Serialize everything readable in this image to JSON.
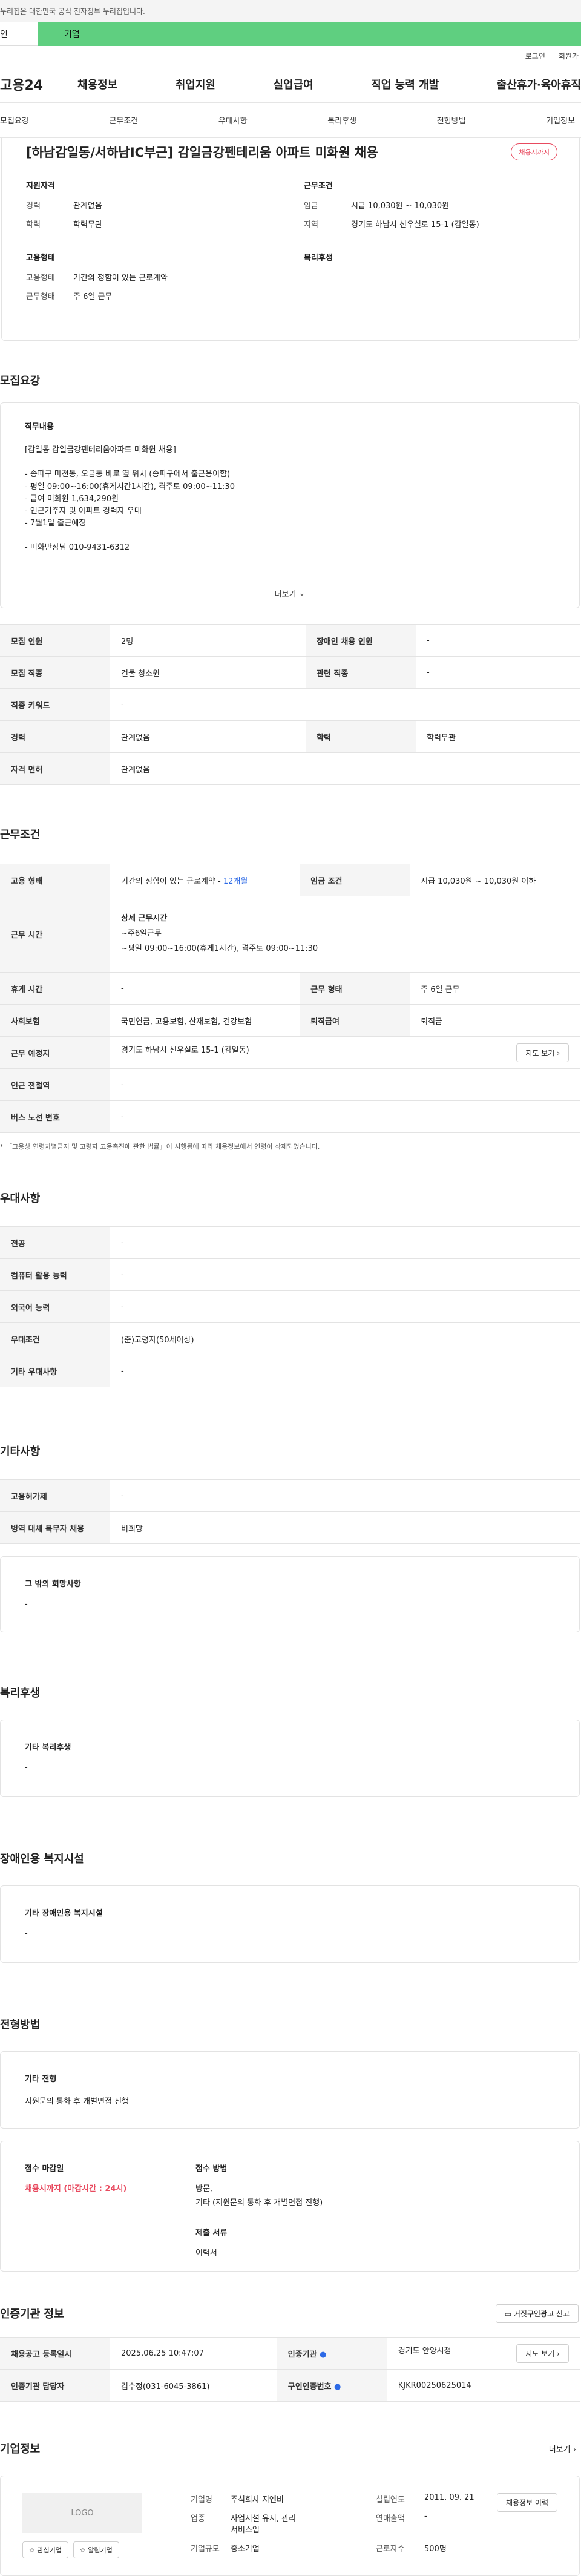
{
  "gov_notice": "누리집은 대한민국 공식 전자정부 누리집입니다.",
  "tabs": {
    "personal": "인",
    "company": "기업"
  },
  "util": {
    "login": "로그인",
    "signup": "회원가"
  },
  "logo": "고용24",
  "gnb": [
    "채용정보",
    "취업지원",
    "실업급여",
    "직업 능력 개발",
    "출산휴가·육아휴직"
  ],
  "anchors": [
    "모집요강",
    "근무조건",
    "우대사항",
    "복리후생",
    "전형방법",
    "기업정보"
  ],
  "job": {
    "title": "[하남감일동/서하남IC부근] 감일금강펜테리움 아파트 미화원 채용",
    "status": "채용시까지",
    "summary": {
      "qual_h": "지원자격",
      "career_k": "경력",
      "career_v": "관계없음",
      "edu_k": "학력",
      "edu_v": "학력무관",
      "cond_h": "근무조건",
      "wage_k": "임금",
      "wage_v": "시급 10,030원 ~ 10,030원",
      "area_k": "지역",
      "area_v": "경기도 하남시 신우실로 15-1 (감일동)",
      "emp_h": "고용형태",
      "emptype_k": "고용형태",
      "emptype_v": "기간의 정함이 있는 근로계약",
      "worktype_k": "근무형태",
      "worktype_v": "주 6일 근무",
      "welfare_h": "복리후생"
    }
  },
  "recruit": {
    "title": "모집요강",
    "duty_h": "직무내용",
    "duty_text": "[감일동   감일금강펜테리움아파트 미화원 채용]\n\n- 송파구 마천동, 오금동 바로 옆 위치 (송파구에서 출근용이함)\n- 평일 09:00~16:00(휴게시간1시간), 격주토 09:00~11:30\n- 급여 미화원 1,634,290원\n- 인근거주자 및 아파트 경력자 우대\n- 7월1일 출근예정\n\n- 미화반장님 010-9431-6312",
    "more": "더보기",
    "rows": [
      [
        "모집 인원",
        "2명",
        "장애인 채용 인원",
        "-"
      ],
      [
        "모집 직종",
        "건물 청소원",
        "관련 직종",
        "-"
      ],
      [
        "직종 키워드",
        "-"
      ],
      [
        "경력",
        "관계없음",
        "학력",
        "학력무관"
      ],
      [
        "자격 면허",
        "관계없음"
      ]
    ]
  },
  "work": {
    "title": "근무조건",
    "emp_k": "고용 형태",
    "emp_v": "기간의 정함이 있는 근로계약 - ",
    "emp_acc": "12개월",
    "wage_k": "임금 조건",
    "wage_v": "시급 10,030원 ~ 10,030원 이하",
    "time_k": "근무 시간",
    "time_h": "상세 근무시간",
    "time_1": "~주6일근무",
    "time_2": "~평일 09:00~16:00(휴게1시간), 격주토 09:00~11:30",
    "rest_k": "휴게 시간",
    "rest_v": "-",
    "form_k": "근무 형태",
    "form_v": "주 6일 근무",
    "ins_k": "사회보험",
    "ins_v": "국민연금, 고용보험, 산재보험, 건강보험",
    "sev_k": "퇴직급여",
    "sev_v": "퇴직금",
    "place_k": "근무 예정지",
    "place_v": "경기도 하남시 신우실로 15-1 (감일동)",
    "map_btn": "지도 보기",
    "sub_k": "인근 전철역",
    "sub_v": "-",
    "bus_k": "버스 노선 번호",
    "bus_v": "-",
    "note": "* 「고용상 연령차별금지 및 고령자 고용촉진에 관한 법률」이 시행됨에 따라 채용정보에서 연령이 삭제되었습니다."
  },
  "prefer": {
    "title": "우대사항",
    "rows": [
      [
        "전공",
        "-"
      ],
      [
        "컴퓨터 활용 능력",
        "-"
      ],
      [
        "외국어 능력",
        "-"
      ],
      [
        "우대조건",
        "(준)고령자(50세이상)"
      ],
      [
        "기타 우대사항",
        "-"
      ]
    ]
  },
  "etc": {
    "title": "기타사항",
    "rows": [
      [
        "고용허가제",
        "-"
      ],
      [
        "병역 대체 복무자 채용",
        "비희망"
      ]
    ],
    "other_h": "그 밖의 희망사항",
    "other_v": "-"
  },
  "welfare": {
    "title": "복리후생",
    "h": "기타 복리후생",
    "v": "-"
  },
  "disabled": {
    "title": "장애인용 복지시설",
    "h": "기타 장애인용 복지시설",
    "v": "-"
  },
  "selection": {
    "title": "전형방법",
    "h": "기타 전형",
    "v": "지원문의 통화 후 개별면접 진행",
    "deadline_h": "접수 마감일",
    "deadline_v": "채용시까지 (마감시간 : 24시)",
    "method_h": "접수 방법",
    "method_1": "방문,",
    "method_2": "기타 (지원문의 통화 후 개별면접 진행)",
    "docs_h": "제출 서류",
    "docs_v": "이력서"
  },
  "cert": {
    "title": "인증기관 정보",
    "report_btn": "거짓구인광고 신고",
    "reg_k": "채용공고 등록일시",
    "reg_v": "2025.06.25 10:47:07",
    "org_k": "인증기관",
    "org_v": "경기도 안양시청",
    "map_btn": "지도 보기",
    "mgr_k": "인증기관 담당자",
    "mgr_v": "김수정(031-6045-3861)",
    "no_k": "구인인증번호",
    "no_v": "KJKR00250625014"
  },
  "company": {
    "title": "기업정보",
    "more": "더보기",
    "logo": "LOGO",
    "fav": "관심기업",
    "follow": "알림기업",
    "name_k": "기업명",
    "name_v": "주식회사 지엔비",
    "ind_k": "업종",
    "ind_v": "사업시설 유지, 관리 서비스업",
    "size_k": "기업규모",
    "size_v": "중소기업",
    "est_k": "설립연도",
    "est_v": "2011. 09. 21",
    "sales_k": "연매출액",
    "sales_v": "-",
    "emp_k": "근로자수",
    "emp_v": "500명",
    "history_btn": "채용정보 이력"
  },
  "colors": {
    "brand_green": "#5fcf80",
    "accent_red": "#e84a5f",
    "accent_blue": "#2d6ae6"
  }
}
